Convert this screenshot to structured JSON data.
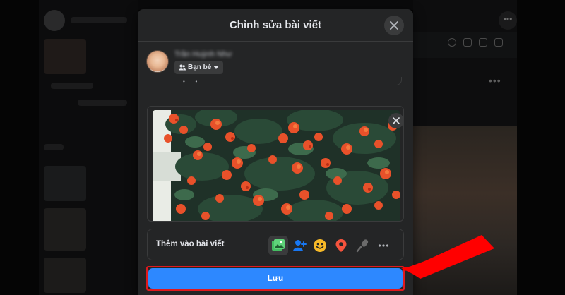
{
  "modal": {
    "title": "Chỉnh sửa bài viết",
    "close_icon": "close-icon"
  },
  "author": {
    "name_blurred": "Trần Huỳnh Như",
    "audience": "Bạn bè",
    "audience_icon": "friends-icon"
  },
  "post": {
    "text_blurred": "• . •"
  },
  "media": {
    "description": "",
    "remove_icon": "close-icon"
  },
  "add_to_post": {
    "label": "Thêm vào bài viết",
    "tools": [
      {
        "icon": "photo-video-icon",
        "color": "#45bd62"
      },
      {
        "icon": "tag-people-icon",
        "color": "#1877f2"
      },
      {
        "icon": "feeling-icon",
        "color": "#f7b928"
      },
      {
        "icon": "location-icon",
        "color": "#f5533d"
      },
      {
        "icon": "microphone-icon",
        "color": "#6b6b6b"
      },
      {
        "icon": "more-icon",
        "color": "#b0b3b8"
      }
    ]
  },
  "save_button": {
    "label": "Lưu",
    "color": "#2d88ff"
  },
  "annotation": {
    "highlight_color": "#e0191d"
  },
  "background": {
    "more_icon": "more-icon"
  }
}
